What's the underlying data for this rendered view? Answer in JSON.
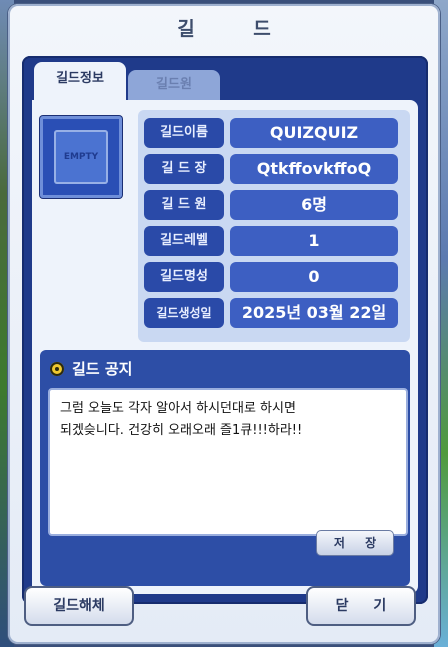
{
  "window": {
    "title": "길 드"
  },
  "tabs": [
    {
      "label": "길드정보",
      "active": true
    },
    {
      "label": "길드원",
      "active": false
    }
  ],
  "emblem": {
    "label": "EMPTY"
  },
  "info": [
    {
      "label": "길드이름",
      "value": "QUIZQUIZ"
    },
    {
      "label": "길 드 장",
      "value": "QtkffovkffoQ"
    },
    {
      "label": "길 드 원",
      "value": "6명"
    },
    {
      "label": "길드레벨",
      "value": "1"
    },
    {
      "label": "길드명성",
      "value": "0"
    },
    {
      "label": "길드생성일",
      "value": "2025년 03월 22일"
    }
  ],
  "notice": {
    "heading": "길드 공지",
    "text": "그럼 오늘도 각자 알아서 하시던대로 하시면\n되겠슺니다. 건강히 오래오래 즐1큐!!!하라!!",
    "save_label": "저 장"
  },
  "buttons": {
    "dissolve": "길드해체",
    "close": "닫 기"
  },
  "colors": {
    "panel": "#1f3a8a",
    "label_bg": "#2a4aa8",
    "value_bg": "#3d5fc2"
  }
}
